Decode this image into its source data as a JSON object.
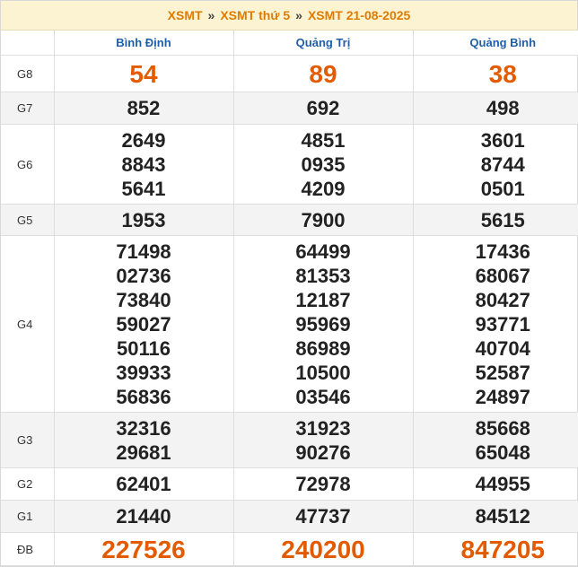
{
  "breadcrumb": {
    "items": [
      "XSMT",
      "XSMT thứ 5",
      "XSMT 21-08-2025"
    ],
    "separator": "»"
  },
  "provinces": [
    "Bình Định",
    "Quảng Trị",
    "Quảng Bình"
  ],
  "prizes": [
    {
      "label": "G8",
      "values": [
        [
          "54"
        ],
        [
          "89"
        ],
        [
          "38"
        ]
      ]
    },
    {
      "label": "G7",
      "values": [
        [
          "852"
        ],
        [
          "692"
        ],
        [
          "498"
        ]
      ]
    },
    {
      "label": "G6",
      "values": [
        [
          "2649",
          "8843",
          "5641"
        ],
        [
          "4851",
          "0935",
          "4209"
        ],
        [
          "3601",
          "8744",
          "0501"
        ]
      ]
    },
    {
      "label": "G5",
      "values": [
        [
          "1953"
        ],
        [
          "7900"
        ],
        [
          "5615"
        ]
      ]
    },
    {
      "label": "G4",
      "values": [
        [
          "71498",
          "02736",
          "73840",
          "59027",
          "50116",
          "39933",
          "56836"
        ],
        [
          "64499",
          "81353",
          "12187",
          "95969",
          "86989",
          "10500",
          "03546"
        ],
        [
          "17436",
          "68067",
          "80427",
          "93771",
          "40704",
          "52587",
          "24897"
        ]
      ]
    },
    {
      "label": "G3",
      "values": [
        [
          "32316",
          "29681"
        ],
        [
          "31923",
          "90276"
        ],
        [
          "85668",
          "65048"
        ]
      ]
    },
    {
      "label": "G2",
      "values": [
        [
          "62401"
        ],
        [
          "72978"
        ],
        [
          "44955"
        ]
      ]
    },
    {
      "label": "G1",
      "values": [
        [
          "21440"
        ],
        [
          "47737"
        ],
        [
          "84512"
        ]
      ]
    },
    {
      "label": "ĐB",
      "values": [
        [
          "227526"
        ],
        [
          "240200"
        ],
        [
          "847205"
        ]
      ]
    }
  ],
  "colors": {
    "accent": "#e07b00",
    "highlight_number": "#e35b00",
    "province_header": "#1e5fa8",
    "breadcrumb_bg": "#fbf3d1"
  }
}
